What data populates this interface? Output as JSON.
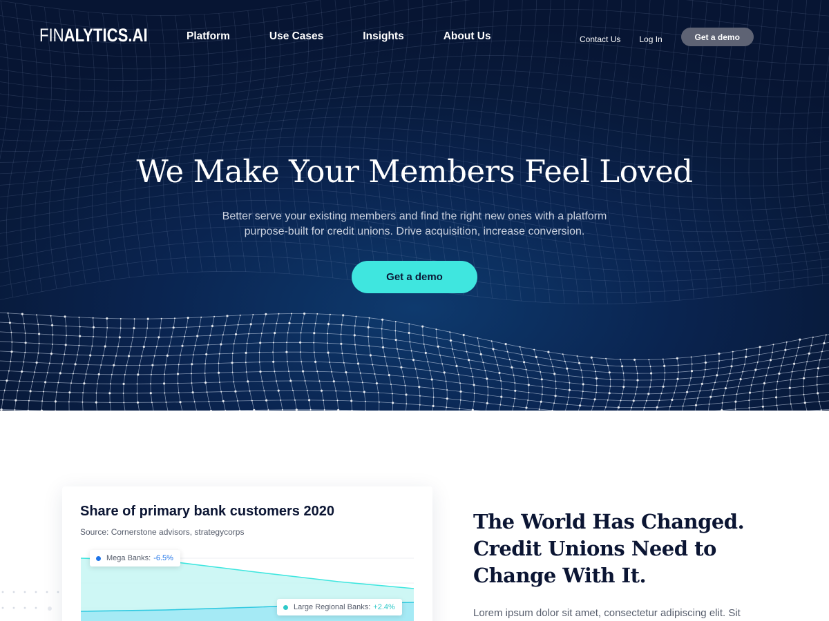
{
  "brand": {
    "logo_light": "FIN",
    "logo_bold": "ALYTICS.AI"
  },
  "nav": {
    "links": [
      "Platform",
      "Use Cases",
      "Insights",
      "About Us"
    ],
    "contact": "Contact Us",
    "login": "Log In",
    "demo": "Get a demo"
  },
  "hero": {
    "title": "We Make Your Members Feel Loved",
    "subtitle_line1": "Better serve your existing members and find the right new ones with a platform",
    "subtitle_line2": "purpose-built for credit unions. Drive acquisition, increase conversion.",
    "cta": "Get a demo"
  },
  "chart_card": {
    "title": "Share of primary bank customers 2020",
    "source": "Source: Cornerstone advisors, strategycorps",
    "chips": {
      "mega": {
        "label": "Mega Banks:",
        "value": "-6.5%"
      },
      "large": {
        "label": "Large Regional Banks:",
        "value": "+2.4%"
      }
    }
  },
  "chart_data": {
    "type": "area",
    "title": "Share of primary bank customers 2020",
    "subtitle": "Source: Cornerstone advisors, strategycorps",
    "series": [
      {
        "name": "Mega Banks",
        "change": "-6.5%",
        "color": "#3fe6df",
        "trend": "decreasing"
      },
      {
        "name": "Large Regional Banks",
        "change": "+2.4%",
        "color": "#2fc9e0",
        "trend": "increasing"
      }
    ],
    "grid": true,
    "legend": "inline-callouts"
  },
  "section": {
    "title_line1": "The World Has Changed.",
    "title_line2": "Credit Unions Need to",
    "title_line3": "Change With It.",
    "body": "Lorem ipsum dolor sit amet, consectetur adipiscing elit. Sit"
  },
  "colors": {
    "hero_bg": "#081a3b",
    "accent": "#3fe6df",
    "nav_demo_bg": "#5e6374",
    "heading": "#0b1533"
  }
}
